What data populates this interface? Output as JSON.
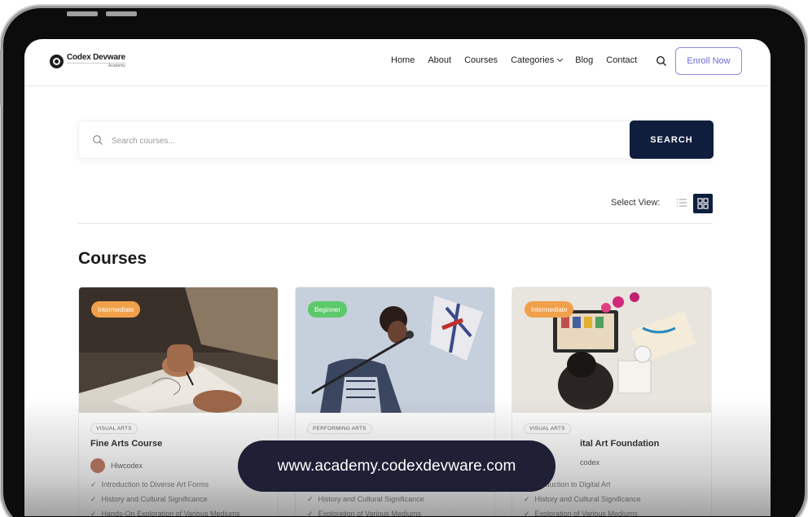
{
  "brand": {
    "name": "Codex Devware",
    "sub": "Academy"
  },
  "nav": {
    "items": [
      {
        "label": "Home"
      },
      {
        "label": "About"
      },
      {
        "label": "Courses"
      },
      {
        "label": "Categories"
      },
      {
        "label": "Blog"
      },
      {
        "label": "Contact"
      }
    ],
    "enroll_label": "Enroll Now"
  },
  "search": {
    "placeholder": "Search courses...",
    "button_label": "SEARCH"
  },
  "view": {
    "label": "Select View:",
    "active": "grid"
  },
  "page_title": "Courses",
  "courses": [
    {
      "level": "Intermediate",
      "category": "VISUAL ARTS",
      "title": "Fine Arts Course",
      "author": "Hlwcodex",
      "features": [
        "Introduction to Diverse Art Forms",
        "History and Cultural Significance",
        "Hands-On Exploration of Various Mediums"
      ]
    },
    {
      "level": "Beginner",
      "category": "PERFORMING ARTS",
      "title": "",
      "author": "",
      "features": [
        "",
        "History and Cultural Significance",
        "Exploration of Various Mediums"
      ]
    },
    {
      "level": "Intermediate",
      "category": "VISUAL ARTS",
      "title": "ital Art Foundation",
      "author": "codex",
      "features": [
        "troduction to Digital Art",
        "History and Cultural Significance",
        "Exploration of Various Mediums"
      ]
    }
  ],
  "overlay_url": "www.academy.codexdevware.com",
  "colors": {
    "primary": "#0f1e3d",
    "accent": "#6a6ad6",
    "intermediate": "#f0a04b",
    "beginner": "#5cc96a"
  }
}
